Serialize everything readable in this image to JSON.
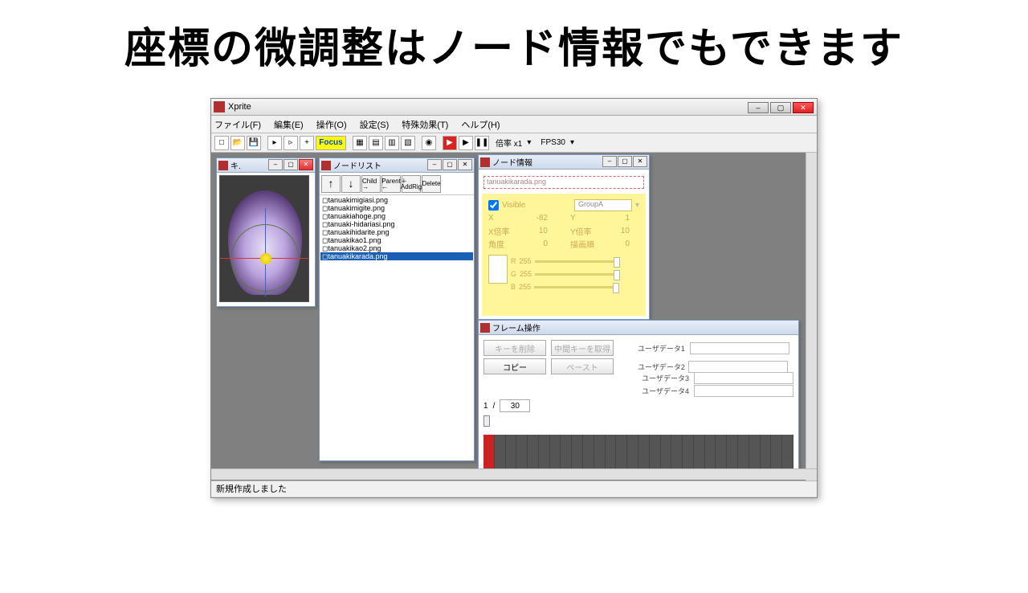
{
  "headline": "座標の微調整はノード情報でもできます",
  "app": {
    "title": "Xprite"
  },
  "menu": {
    "file": "ファイル(F)",
    "edit": "編集(E)",
    "ops": "操作(O)",
    "settings": "設定(S)",
    "fx": "特殊効果(T)",
    "help": "ヘルプ(H)"
  },
  "toolbar": {
    "focus": "Focus",
    "zoom": "倍率 x1",
    "fps": "FPS30"
  },
  "status": "新規作成しました",
  "preview": {
    "title": "キ."
  },
  "nodelist": {
    "title": "ノードリスト",
    "buttons": {
      "up": "↑",
      "down": "↓",
      "child": "Child →",
      "parent": "Parent ←",
      "addrig": "＋ AddRig",
      "delete": "Delete"
    },
    "items": [
      "◻tanuakimigiasi.png",
      "◻tanuakimigite.png",
      "◻tanuakiahoge.png",
      "◻tanuaki-hidariasi.png",
      "◻tanuakihidarite.png",
      "◻tanuakikao1.png",
      "◻tanuakikao2.png",
      "◻tanuakikarada.png"
    ],
    "selected_index": 7
  },
  "nodeinfo": {
    "title": "ノード情報",
    "name": "tanuakikarada.png",
    "visible_label": "Visible",
    "group": "GroupA",
    "x_lbl": "X",
    "x_val": "-82",
    "y_lbl": "Y",
    "y_val": "1",
    "xscale_lbl": "X倍率",
    "xscale_val": "10",
    "yscale_lbl": "Y倍率",
    "yscale_val": "10",
    "angle_lbl": "角度",
    "angle_val": "0",
    "order_lbl": "描画順",
    "order_val": "0",
    "r_lbl": "R",
    "r_val": "255",
    "g_lbl": "G",
    "g_val": "255",
    "b_lbl": "B",
    "b_val": "255"
  },
  "frame": {
    "title": "フレーム操作",
    "delkey": "キーを削除",
    "midkey": "中間キーを取得",
    "copy": "コピー",
    "paste": "ペースト",
    "ud1": "ユーザデータ1",
    "ud2": "ユーザデータ2",
    "ud3": "ユーザデータ3",
    "ud4": "ユーザデータ4",
    "cur": "1",
    "sep": "/",
    "total": "30"
  }
}
